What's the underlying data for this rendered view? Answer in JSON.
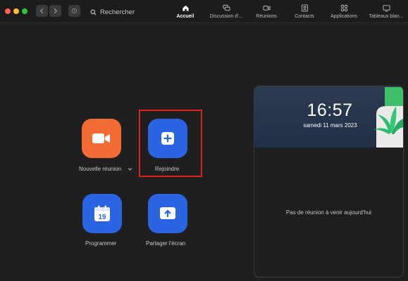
{
  "toolbar": {
    "search_label": "Rechercher"
  },
  "tabs": [
    {
      "label": "Accueil",
      "icon": "home-icon",
      "active": true
    },
    {
      "label": "Discussion d’...",
      "icon": "chat-icon",
      "active": false
    },
    {
      "label": "Réunions",
      "icon": "video-icon",
      "active": false
    },
    {
      "label": "Contacts",
      "icon": "contacts-icon",
      "active": false
    },
    {
      "label": "Applications",
      "icon": "apps-icon",
      "active": false
    },
    {
      "label": "Tableaux blan...",
      "icon": "whiteboard-icon",
      "active": false
    }
  ],
  "actions": {
    "new_meeting": "Nouvelle réunion",
    "join": "Rejoindre",
    "schedule": "Programmer",
    "schedule_day": "19",
    "share_screen": "Partager l'écran"
  },
  "card": {
    "time": "16:57",
    "date": "samedi 11 mars 2023",
    "empty_message": "Pas de réunion à venir aujourd'hui"
  },
  "colors": {
    "accent_blue": "#2a64e3",
    "accent_orange": "#f26b35",
    "highlight_red": "#e0201b"
  }
}
